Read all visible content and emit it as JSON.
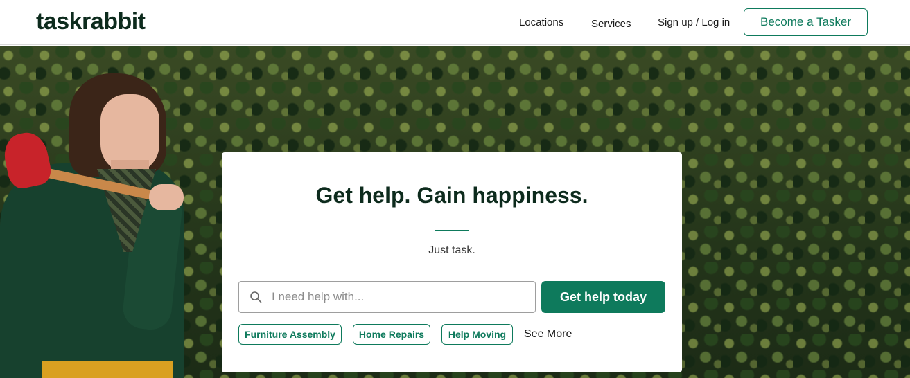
{
  "header": {
    "logo": "taskrabbit",
    "nav": {
      "locations": "Locations",
      "services": "Services",
      "signup_login": "Sign up / Log in",
      "become_tasker": "Become a Tasker"
    }
  },
  "hero": {
    "headline": "Get help. Gain happiness.",
    "subtitle": "Just task.",
    "search": {
      "placeholder": "I need help with...",
      "value": ""
    },
    "cta_label": "Get help today",
    "quick_tasks": [
      "Furniture Assembly",
      "Home Repairs",
      "Help Moving"
    ],
    "see_more": "See More"
  },
  "colors": {
    "brand_green": "#0e7a5c",
    "logo_dark": "#0d2b1d"
  },
  "icons": {
    "search": "search-icon"
  }
}
